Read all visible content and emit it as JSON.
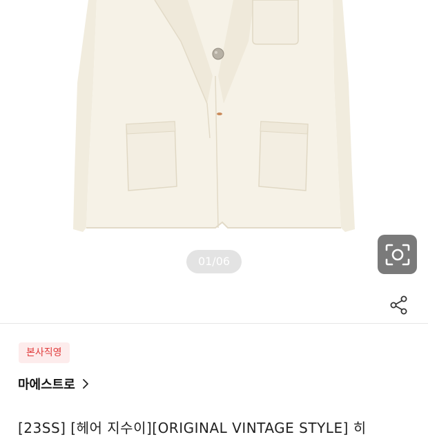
{
  "gallery": {
    "image_counter": "01/06",
    "image_alt": "아이보리 재킷 상품 이미지"
  },
  "actions": {
    "lens_icon": "camera-scan-icon",
    "share_icon": "share-icon"
  },
  "product": {
    "badge": "본사직영",
    "brand": "마에스트로",
    "title": "[23SS] [헤어 지수이][ORIGINAL VINTAGE STYLE] 히"
  },
  "colors": {
    "badge_bg": "#fdecec",
    "badge_text": "#e03a3a",
    "lens_button_bg": "#7a7a7a"
  }
}
